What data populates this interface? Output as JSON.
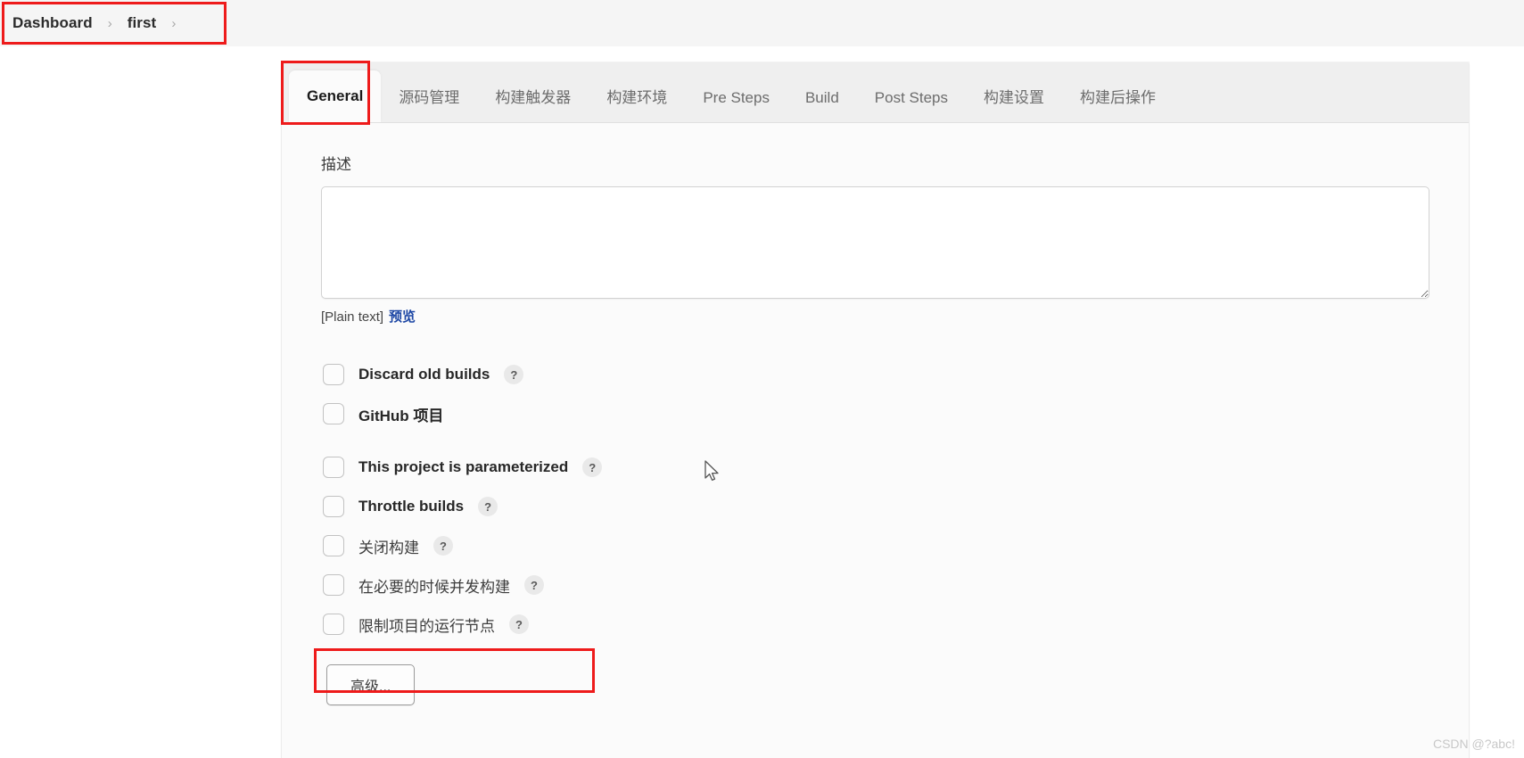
{
  "breadcrumb": {
    "items": [
      {
        "label": "Dashboard"
      },
      {
        "label": "first"
      }
    ],
    "separator": "›"
  },
  "tabs": [
    {
      "label": "General",
      "active": true
    },
    {
      "label": "源码管理",
      "active": false
    },
    {
      "label": "构建触发器",
      "active": false
    },
    {
      "label": "构建环境",
      "active": false
    },
    {
      "label": "Pre Steps",
      "active": false
    },
    {
      "label": "Build",
      "active": false
    },
    {
      "label": "Post Steps",
      "active": false
    },
    {
      "label": "构建设置",
      "active": false
    },
    {
      "label": "构建后操作",
      "active": false
    }
  ],
  "form": {
    "description_label": "描述",
    "description_value": "",
    "description_placeholder": "",
    "plain_text_note": "[Plain text]",
    "preview_link": "预览",
    "advanced_button": "高级...",
    "help_glyph": "?"
  },
  "checkboxes": [
    {
      "label": "Discard old builds",
      "checked": false,
      "has_help": true,
      "lang": "en"
    },
    {
      "label": "GitHub 项目",
      "checked": false,
      "has_help": false,
      "lang": "en"
    },
    {
      "label": "This project is parameterized",
      "checked": false,
      "has_help": true,
      "lang": "en"
    },
    {
      "label": "Throttle builds",
      "checked": false,
      "has_help": true,
      "lang": "en"
    },
    {
      "label": "关闭构建",
      "checked": false,
      "has_help": true,
      "lang": "cn"
    },
    {
      "label": "在必要的时候并发构建",
      "checked": false,
      "has_help": true,
      "lang": "cn"
    },
    {
      "label": "限制项目的运行节点",
      "checked": false,
      "has_help": true,
      "lang": "cn"
    }
  ],
  "annotations": {
    "color": "#ee1b1b",
    "targets": [
      "breadcrumb",
      "general-tab",
      "restrict-node-checkbox"
    ]
  },
  "watermark": "CSDN @?abc!",
  "colors": {
    "accent_link": "#1d47a5",
    "annotation": "#ee1b1b",
    "tabbar_bg": "#efefef",
    "card_bg": "#fbfbfb",
    "breadcrumb_bg": "#f5f5f5"
  }
}
